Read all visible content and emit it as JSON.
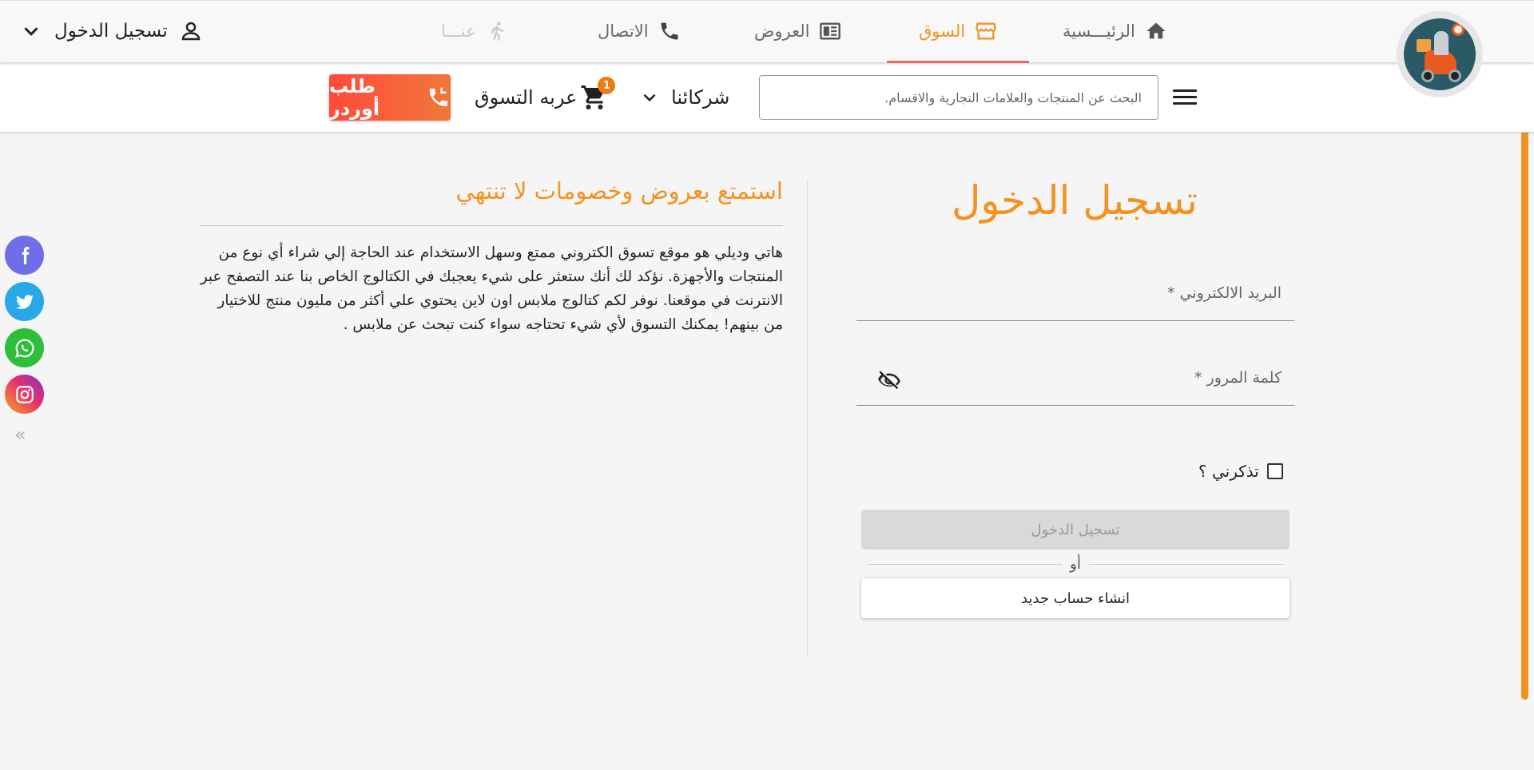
{
  "colors": {
    "accent": "#f39220",
    "order_button": "#ff5533",
    "facebook": "#6e6ee6",
    "twitter": "#29a8e8",
    "whatsapp": "#2dbf3c"
  },
  "header": {
    "nav": [
      {
        "label": "الرئيـــسية",
        "icon": "home-icon"
      },
      {
        "label": "السوق",
        "icon": "store-icon",
        "active": true
      },
      {
        "label": "العروض",
        "icon": "newspaper-icon"
      },
      {
        "label": "الاتصال",
        "icon": "phone-icon"
      },
      {
        "label": "عنـــا",
        "icon": "walking-icon"
      }
    ],
    "login_label": "تسجيل الدخول"
  },
  "subbar": {
    "search_placeholder": "البحث عن المنتجات والعلامات التجارية والاقسام.",
    "partners_label": "شركائنا",
    "cart_label": "عربه التسوق",
    "cart_count": "1",
    "order_label": "طلب أوردر"
  },
  "promo": {
    "title": "استمتع بعروض وخصومات لا تنتهي",
    "text": "هاتي وديلي هو موقع تسوق الكتروني ممتع وسهل الاستخدام عند الحاجة إلي شراء أي نوع من المنتجات والأجهزة. نؤكد لك أنك ستعثر على شيء يعجبك في الكتالوج الخاص بنا عند التصفح عبر الانترنت في موقعنا. نوفر لكم كتالوج ملابس اون لاين يحتوي علي أكثر من مليون منتج للاختيار من بينهم! يمكنك التسوق لأي شيء تحتاجه سواء كنت تبحث عن ملابس ."
  },
  "login": {
    "title": "تسجيل الدخول",
    "email_label": "البريد الالكتروني *",
    "password_label": "كلمة المرور *",
    "remember_label": "تذكرني ؟",
    "submit_label": "تسجيل الدخول",
    "or_label": "أو",
    "register_label": "انشاء حساب جديد"
  },
  "social": [
    "facebook-icon",
    "twitter-icon",
    "whatsapp-icon",
    "instagram-icon"
  ]
}
